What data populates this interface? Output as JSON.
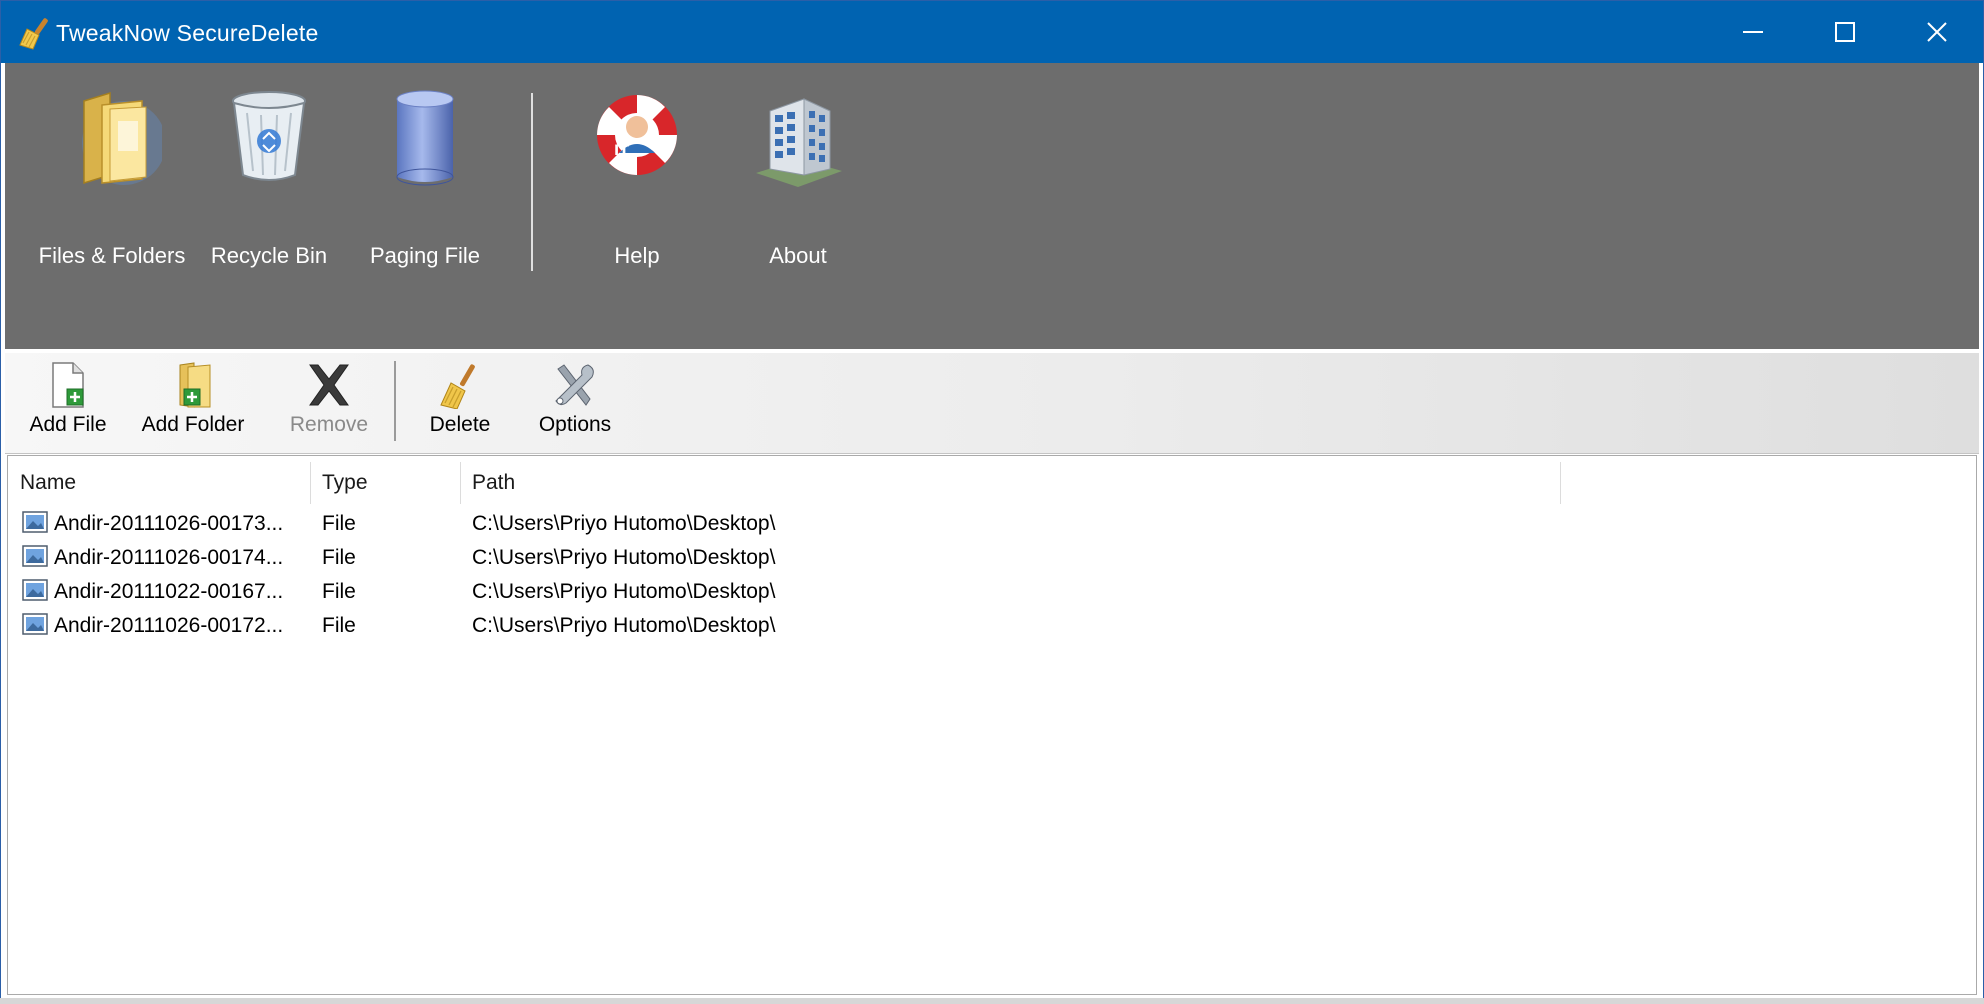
{
  "window": {
    "title": "TweakNow SecureDelete"
  },
  "nav": {
    "items": [
      {
        "label": "Files & Folders",
        "icon": "folder-icon"
      },
      {
        "label": "Recycle Bin",
        "icon": "recycle-bin-icon"
      },
      {
        "label": "Paging File",
        "icon": "paging-file-icon"
      },
      {
        "label": "Help",
        "icon": "lifebuoy-icon"
      },
      {
        "label": "About",
        "icon": "building-icon"
      }
    ]
  },
  "toolbar": {
    "add_file": "Add File",
    "add_folder": "Add Folder",
    "remove": "Remove",
    "delete": "Delete",
    "options": "Options"
  },
  "list": {
    "columns": [
      "Name",
      "Type",
      "Path"
    ],
    "rows": [
      {
        "name": "Andir-20111026-00173...",
        "type": "File",
        "path": "C:\\Users\\Priyo Hutomo\\Desktop\\"
      },
      {
        "name": "Andir-20111026-00174...",
        "type": "File",
        "path": "C:\\Users\\Priyo Hutomo\\Desktop\\"
      },
      {
        "name": "Andir-20111022-00167...",
        "type": "File",
        "path": "C:\\Users\\Priyo Hutomo\\Desktop\\"
      },
      {
        "name": "Andir-20111026-00172...",
        "type": "File",
        "path": "C:\\Users\\Priyo Hutomo\\Desktop\\"
      }
    ]
  },
  "colors": {
    "titlebar": "#0063b1",
    "nav_panel": "#6d6d6d"
  }
}
